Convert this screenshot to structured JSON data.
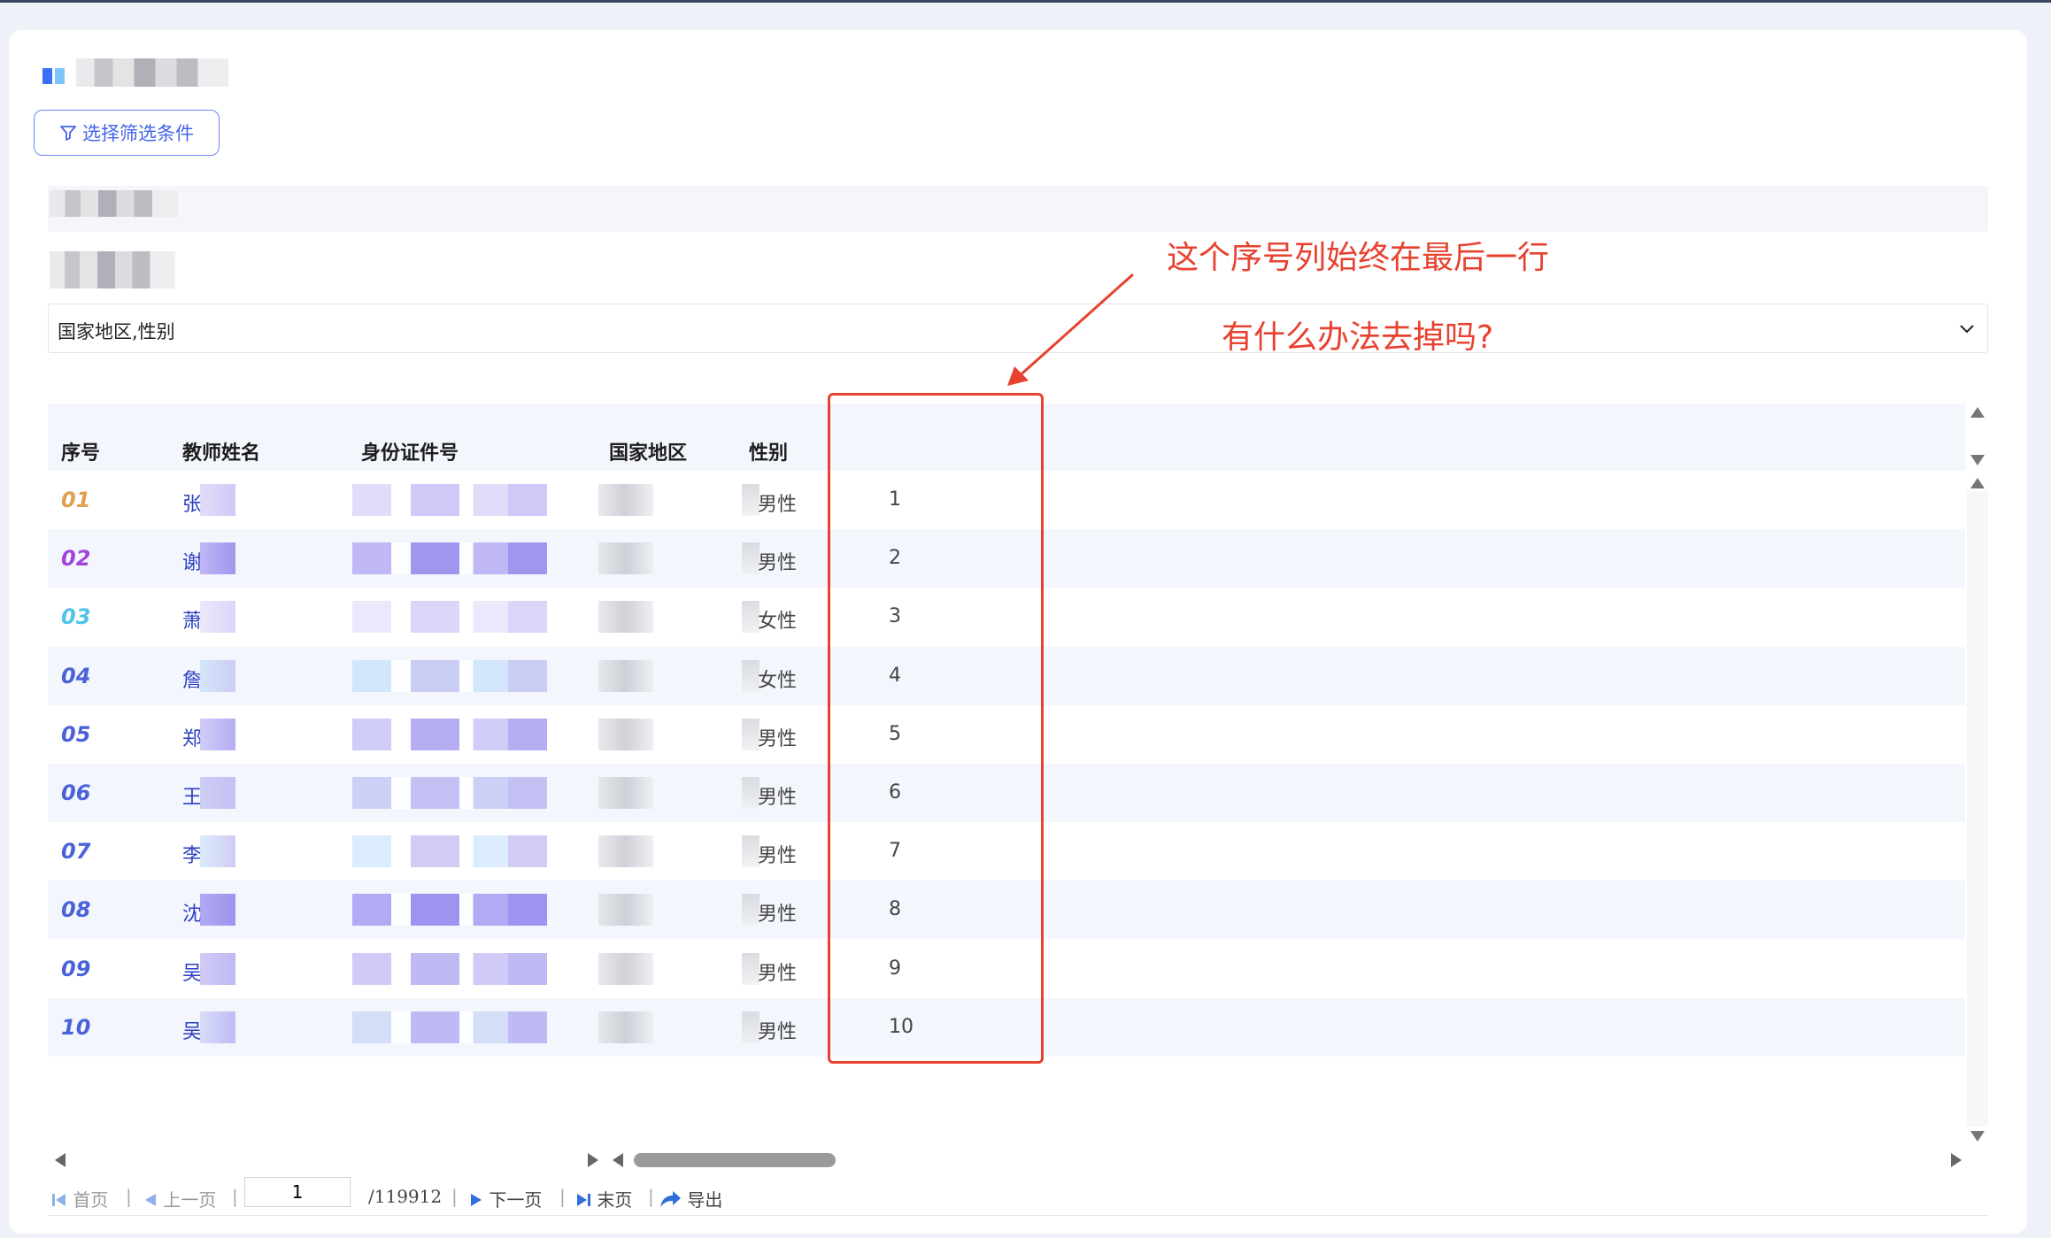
{
  "filter_button": {
    "label": "选择筛选条件",
    "icon": "filter-icon"
  },
  "column_select": {
    "value": "国家地区,性别"
  },
  "annotation": {
    "line1": "这个序号列始终在最后一行",
    "line2": "有什么办法去掉吗?"
  },
  "table": {
    "headers": [
      "序号",
      "教师姓名",
      "身份证件号",
      "国家地区",
      "性别"
    ],
    "rows": [
      {
        "seq": "01",
        "seq_color": "#e0a04c",
        "name": "张",
        "sex": "男性",
        "index": "1"
      },
      {
        "seq": "02",
        "seq_color": "#a045d8",
        "name": "谢",
        "sex": "男性",
        "index": "2"
      },
      {
        "seq": "03",
        "seq_color": "#4fc3e8",
        "name": "萧",
        "sex": "女性",
        "index": "3"
      },
      {
        "seq": "04",
        "seq_color": "#4a62d8",
        "name": "詹",
        "sex": "女性",
        "index": "4"
      },
      {
        "seq": "05",
        "seq_color": "#4a62d8",
        "name": "郑",
        "sex": "男性",
        "index": "5"
      },
      {
        "seq": "06",
        "seq_color": "#4a62d8",
        "name": "王",
        "sex": "男性",
        "index": "6"
      },
      {
        "seq": "07",
        "seq_color": "#4a62d8",
        "name": "李",
        "sex": "男性",
        "index": "7"
      },
      {
        "seq": "08",
        "seq_color": "#4a62d8",
        "name": "沈",
        "sex": "男性",
        "index": "8"
      },
      {
        "seq": "09",
        "seq_color": "#4a62d8",
        "name": "吴",
        "sex": "男性",
        "index": "9"
      },
      {
        "seq": "10",
        "seq_color": "#4a62d8",
        "name": "吴",
        "sex": "男性",
        "index": "10"
      }
    ]
  },
  "pager": {
    "first": "首页",
    "prev": "上一页",
    "page": "1",
    "total": "/119912",
    "next": "下一页",
    "last": "末页",
    "export": "导出"
  },
  "colors": {
    "accent": "#4564e8",
    "annotation": "#e8412f"
  }
}
